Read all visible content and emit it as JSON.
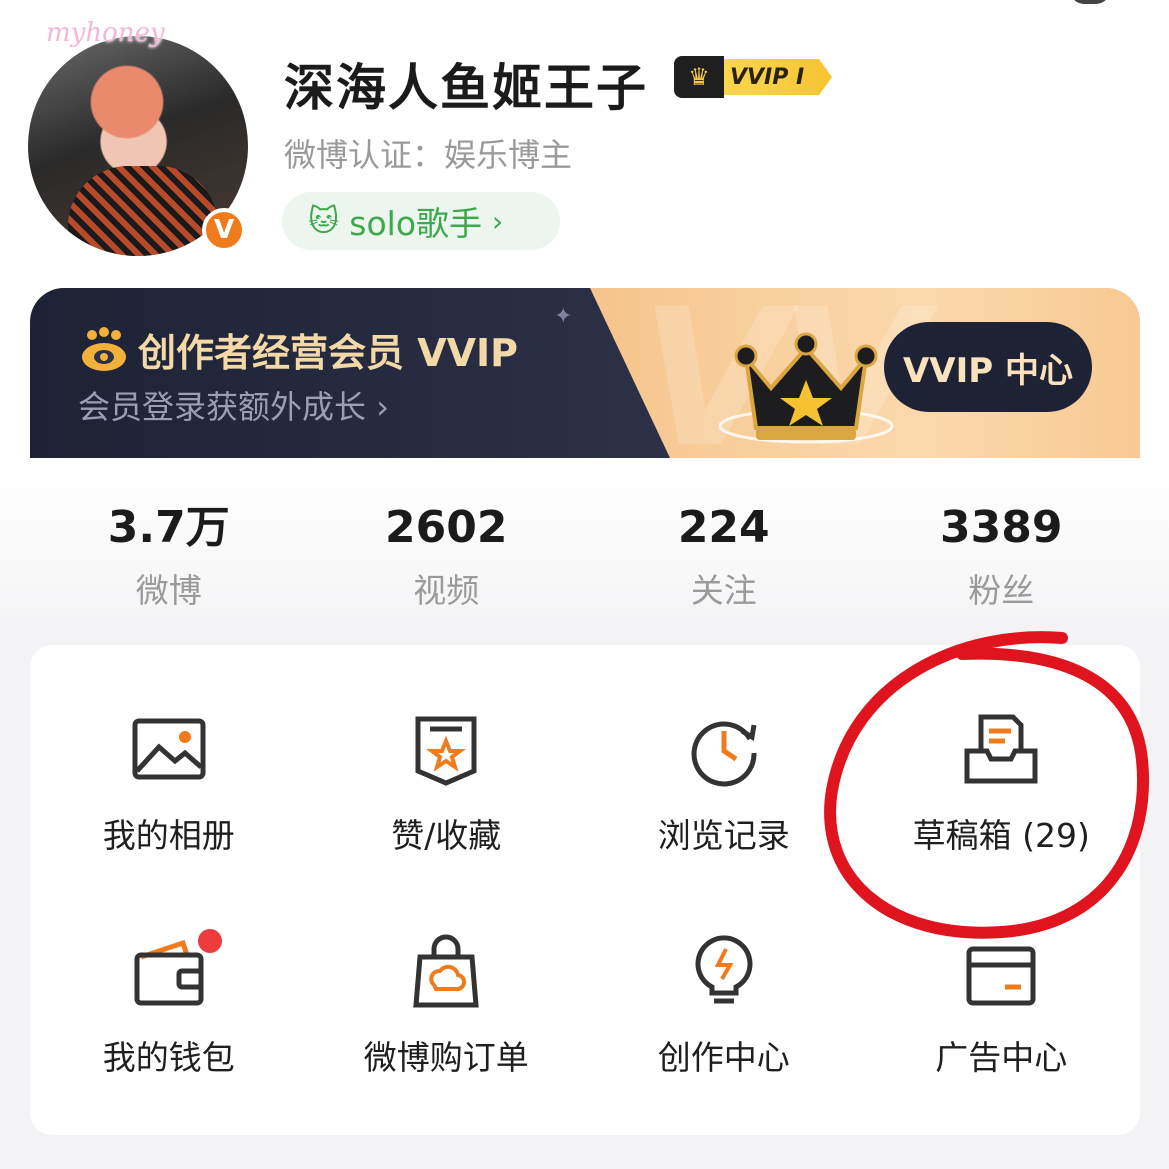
{
  "profile": {
    "avatar_watermark": "myhoney",
    "name": "深海人鱼姬王子",
    "vvip_badge": "VVIP I",
    "certification": "微博认证：娱乐博主",
    "tag": "solo歌手",
    "verify_badge": "V"
  },
  "banner": {
    "title": "创作者经营会员 VVIP",
    "subtitle": "会员登录获额外成长",
    "button": "VVIP 中心"
  },
  "stats": [
    {
      "value": "3.7万",
      "label": "微博"
    },
    {
      "value": "2602",
      "label": "视频"
    },
    {
      "value": "224",
      "label": "关注"
    },
    {
      "value": "3389",
      "label": "粉丝"
    }
  ],
  "grid": [
    {
      "label": "我的相册",
      "icon": "photo-album-icon"
    },
    {
      "label": "赞/收藏",
      "icon": "favorite-star-icon"
    },
    {
      "label": "浏览记录",
      "icon": "history-clock-icon"
    },
    {
      "label": "草稿箱 (29)",
      "icon": "drafts-tray-icon"
    },
    {
      "label": "我的钱包",
      "icon": "wallet-icon"
    },
    {
      "label": "微博购订单",
      "icon": "shopping-bag-icon"
    },
    {
      "label": "创作中心",
      "icon": "lightbulb-icon"
    },
    {
      "label": "广告中心",
      "icon": "ad-card-icon"
    }
  ],
  "colors": {
    "accent_orange": "#f07b1d",
    "annotation_red": "#e0141e",
    "tag_green": "#3ea84d",
    "banner_dark": "#1e2235"
  }
}
